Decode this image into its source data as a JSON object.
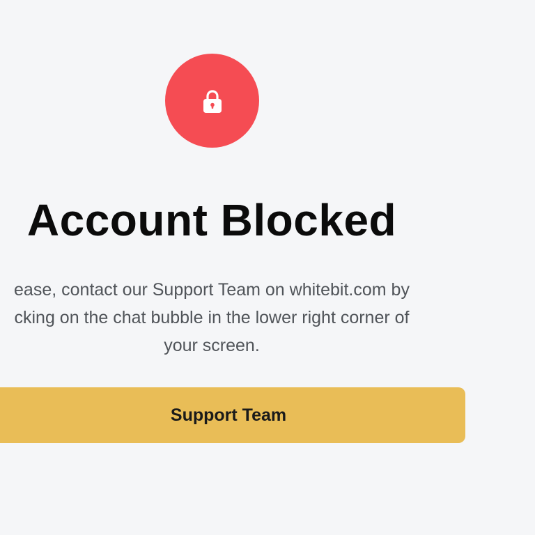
{
  "status": {
    "icon": "lock-icon",
    "title": "Account Blocked",
    "message_lines": [
      "ease, contact our Support Team on whitebit.com by",
      "cking on the chat bubble in the lower right corner of",
      "your screen."
    ]
  },
  "actions": {
    "support_label": "Support Team"
  },
  "colors": {
    "background": "#f5f6f8",
    "danger": "#f54c53",
    "accent": "#e9bd57",
    "title": "#0b0b0b",
    "body_text": "#505459"
  }
}
